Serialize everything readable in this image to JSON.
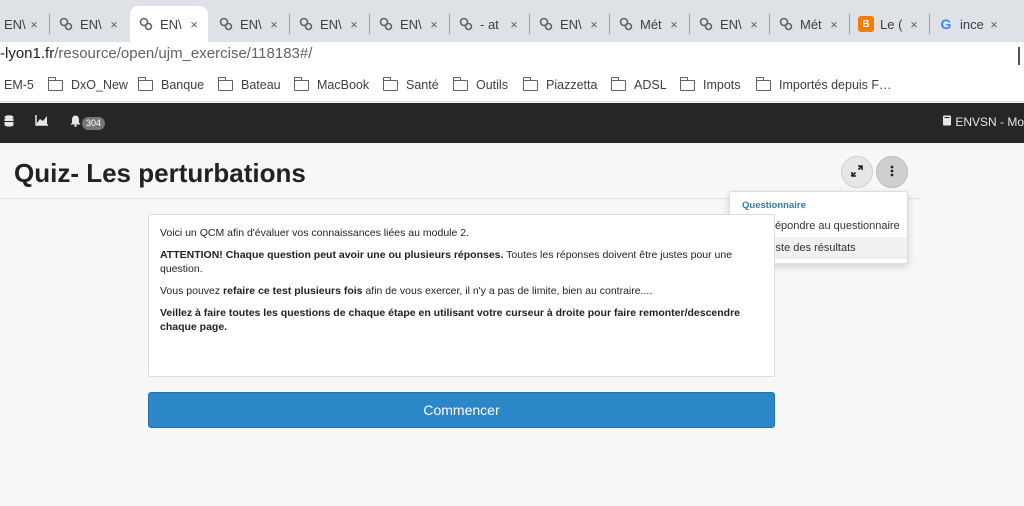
{
  "browser": {
    "tabs": [
      {
        "title": "EN\\",
        "favicon": "moodle-icon",
        "active": false
      },
      {
        "title": "EN\\",
        "favicon": "moodle-icon",
        "active": false
      },
      {
        "title": "EN\\",
        "favicon": "moodle-icon",
        "active": true
      },
      {
        "title": "EN\\",
        "favicon": "moodle-icon",
        "active": false
      },
      {
        "title": "EN\\",
        "favicon": "moodle-icon",
        "active": false
      },
      {
        "title": "EN\\",
        "favicon": "moodle-icon",
        "active": false
      },
      {
        "title": "- at",
        "favicon": "moodle-icon",
        "active": false
      },
      {
        "title": "EN\\",
        "favicon": "moodle-icon",
        "active": false
      },
      {
        "title": "Mét",
        "favicon": "moodle-icon",
        "active": false
      },
      {
        "title": "EN\\",
        "favicon": "moodle-icon",
        "active": false
      },
      {
        "title": "Mét",
        "favicon": "moodle-icon",
        "active": false
      },
      {
        "title": "Le (",
        "favicon": "blogger-icon",
        "active": false
      },
      {
        "title": "ince",
        "favicon": "google-icon",
        "active": false
      }
    ],
    "close_glyph": "×",
    "url_host": "-lyon1.fr",
    "url_path": "/resource/open/ujm_exercise/118183#/",
    "bookmarks": [
      {
        "label": "EM-5",
        "folder": false
      },
      {
        "label": "DxO_New",
        "folder": true
      },
      {
        "label": "Banque",
        "folder": true
      },
      {
        "label": "Bateau",
        "folder": true
      },
      {
        "label": "MacBook",
        "folder": true
      },
      {
        "label": "Santé",
        "folder": true
      },
      {
        "label": "Outils",
        "folder": true
      },
      {
        "label": "Piazzetta",
        "folder": true
      },
      {
        "label": "ADSL",
        "folder": true
      },
      {
        "label": "Impots",
        "folder": true
      },
      {
        "label": "Importés depuis F…",
        "folder": true
      }
    ]
  },
  "navbar": {
    "notification_count": "304",
    "workspace_label": "ENVSN - Mo"
  },
  "page": {
    "title": "Quiz- Les perturbations"
  },
  "dropdown": {
    "header": "Questionnaire",
    "items": [
      {
        "label": "Répondre au questionnaire",
        "icon": "home-icon"
      },
      {
        "label": "Liste des résultats",
        "icon": "list-icon"
      }
    ]
  },
  "intro": {
    "p1": "Voici un QCM afin d'évaluer vos connaissances liées au module 2.",
    "p2_bold": "ATTENTION! Chaque question peut avoir une ou plusieurs réponses.",
    "p2_rest": " Toutes les réponses doivent être justes pour une question.",
    "p3_start": "Vous pouvez ",
    "p3_bold": "refaire ce test plusieurs fois",
    "p3_rest": " afin de vous exercer, il n'y a pas de limite, bien au contraire....",
    "p4_bold": "Veillez à faire toutes les questions de chaque étape en utilisant votre curseur à droite pour faire remonter/descendre chaque page."
  },
  "start_button": "Commencer",
  "colors": {
    "accent": "#2b87c8",
    "navbar": "#262626",
    "dropdown_header": "#337ab7"
  }
}
